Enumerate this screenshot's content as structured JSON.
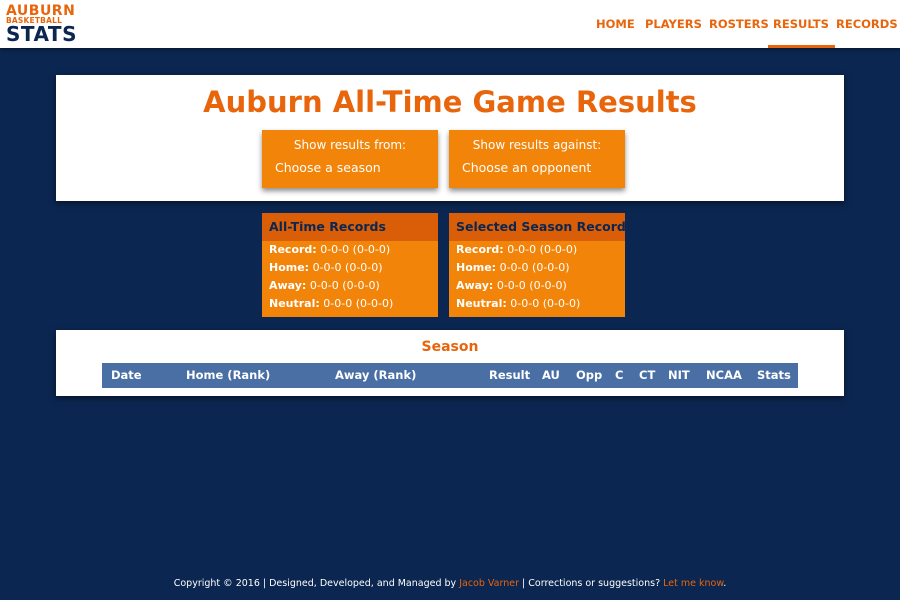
{
  "logo": {
    "line1": "AUBURN",
    "line2": "BASKETBALL",
    "line3": "STATS"
  },
  "nav": {
    "items": [
      {
        "label": "HOME",
        "active": false
      },
      {
        "label": "PLAYERS",
        "active": false
      },
      {
        "label": "ROSTERS",
        "active": false
      },
      {
        "label": "RESULTS",
        "active": true
      },
      {
        "label": "RECORDS",
        "active": false
      }
    ]
  },
  "page": {
    "title": "Auburn All-Time Game Results"
  },
  "filters": {
    "season": {
      "label": "Show results from:",
      "value": "Choose a season"
    },
    "opponent": {
      "label": "Show results against:",
      "value": "Choose an opponent"
    }
  },
  "records": {
    "all_time": {
      "title": "All-Time Records",
      "lines": [
        {
          "label": "Record:",
          "value": "0-0-0 (0-0-0)"
        },
        {
          "label": "Home:",
          "value": "0-0-0 (0-0-0)"
        },
        {
          "label": "Away:",
          "value": "0-0-0 (0-0-0)"
        },
        {
          "label": "Neutral:",
          "value": "0-0-0 (0-0-0)"
        }
      ]
    },
    "season": {
      "title": "Selected Season Records",
      "lines": [
        {
          "label": "Record:",
          "value": "0-0-0 (0-0-0)"
        },
        {
          "label": "Home:",
          "value": "0-0-0 (0-0-0)"
        },
        {
          "label": "Away:",
          "value": "0-0-0 (0-0-0)"
        },
        {
          "label": "Neutral:",
          "value": "0-0-0 (0-0-0)"
        }
      ]
    }
  },
  "season_table": {
    "title": "Season",
    "columns": [
      "Date",
      "Home (Rank)",
      "Away (Rank)",
      "Result",
      "AU",
      "Opp",
      "C",
      "CT",
      "NIT",
      "NCAA",
      "Stats"
    ]
  },
  "footer": {
    "text1": "Copyright © 2016 | Designed, Developed, and Managed by ",
    "author": "Jacob Varner",
    "text2": " | Corrections or suggestions? ",
    "contact": "Let me know",
    "text3": "."
  },
  "colors": {
    "navy": "#0b2650",
    "orange": "#e8650c",
    "box_orange": "#f28409",
    "table_blue": "#4a6fa5"
  }
}
